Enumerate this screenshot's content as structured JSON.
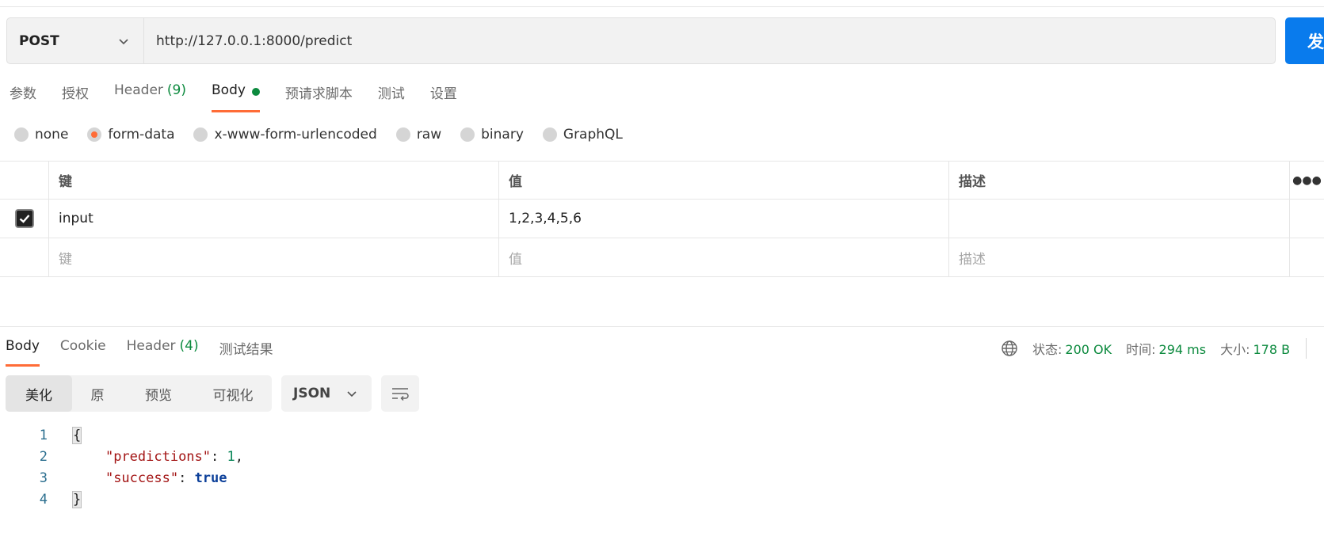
{
  "request": {
    "method": "POST",
    "url": "http://127.0.0.1:8000/predict",
    "send_label": "发"
  },
  "request_tabs": [
    {
      "label": "参数"
    },
    {
      "label": "授权"
    },
    {
      "label": "Header",
      "count": "(9)"
    },
    {
      "label": "Body"
    },
    {
      "label": "预请求脚本"
    },
    {
      "label": "测试"
    },
    {
      "label": "设置"
    }
  ],
  "body_types": [
    "none",
    "form-data",
    "x-www-form-urlencoded",
    "raw",
    "binary",
    "GraphQL"
  ],
  "params_table": {
    "headers": {
      "key": "键",
      "value": "值",
      "desc": "描述"
    },
    "rows": [
      {
        "key": "input",
        "value": "1,2,3,4,5,6",
        "desc": ""
      }
    ],
    "placeholder": {
      "key": "键",
      "value": "值",
      "desc": "描述"
    }
  },
  "response_tabs": [
    {
      "label": "Body"
    },
    {
      "label": "Cookie"
    },
    {
      "label": "Header",
      "count": "(4)"
    },
    {
      "label": "测试结果"
    }
  ],
  "response_status": {
    "status_label": "状态:",
    "status_value": "200 OK",
    "time_label": "时间:",
    "time_value": "294 ms",
    "size_label": "大小:",
    "size_value": "178 B"
  },
  "view_modes": [
    "美化",
    "原",
    "预览",
    "可视化"
  ],
  "format": "JSON",
  "code": {
    "line_numbers": [
      "1",
      "2",
      "3",
      "4"
    ],
    "open_brace": "{",
    "close_brace": "}",
    "pairs": [
      {
        "key": "\"predictions\"",
        "value": "1"
      },
      {
        "key": "\"success\"",
        "value": "true"
      }
    ]
  },
  "colors": {
    "accent": "#ff6c37",
    "send_button": "#097bed",
    "success_green": "#0c8a3e"
  }
}
